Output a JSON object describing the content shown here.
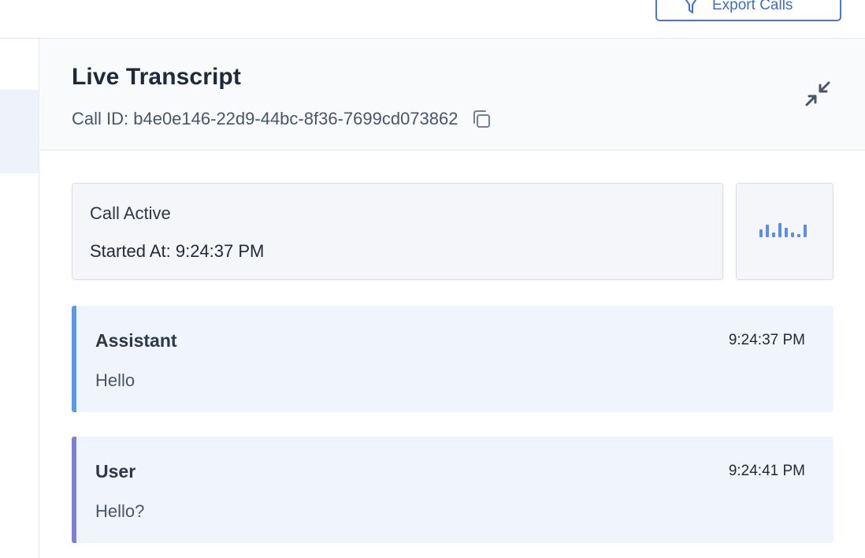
{
  "toolbar": {
    "export_label": "Export Calls",
    "export_icon": "filter-icon"
  },
  "transcript": {
    "title": "Live Transcript",
    "call_id": "Call ID: b4e0e146-22d9-44bc-8f36-7699cd073862",
    "copy_icon": "copy-icon",
    "collapse_icon": "collapse-icon"
  },
  "status": {
    "state": "Call Active",
    "started": "Started At: 9:24:37 PM",
    "waveform_icon": "audio-waveform-icon",
    "accent_color": "#5b8def"
  },
  "messages": [
    {
      "role": "Assistant",
      "time": "9:24:37 PM",
      "text": "Hello",
      "color": "#5b9ae8"
    },
    {
      "role": "User",
      "time": "9:24:41 PM",
      "text": "Hello?",
      "color": "#7b7fd8"
    }
  ]
}
